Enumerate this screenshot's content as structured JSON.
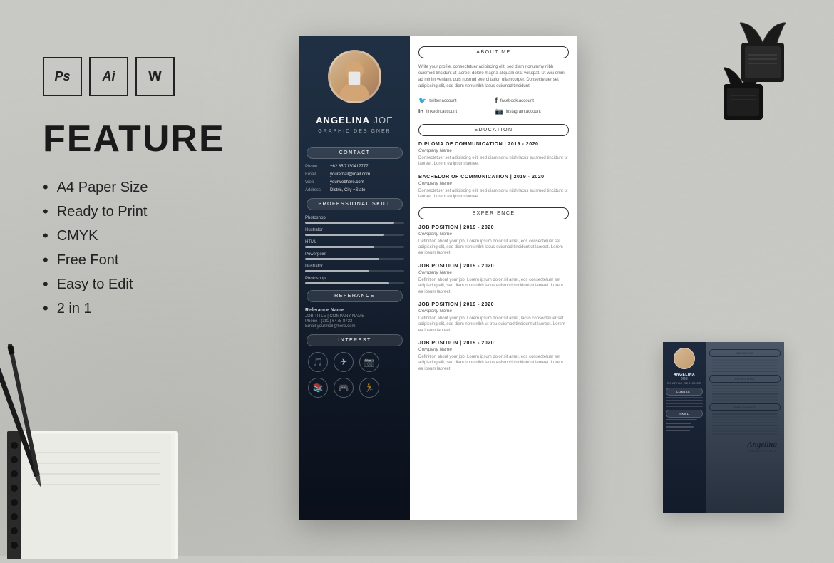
{
  "page": {
    "background_color": "#c8c5c0"
  },
  "software_icons": [
    {
      "id": "ps",
      "label": "Ps"
    },
    {
      "id": "ai",
      "label": "Ai"
    },
    {
      "id": "wd",
      "label": "W"
    }
  ],
  "feature_section": {
    "title": "FEATURE",
    "items": [
      "A4 Paper Size",
      "Ready to Print",
      "CMYK",
      "Free Font",
      "Easy to Edit",
      "2 in 1"
    ]
  },
  "cv_main": {
    "person": {
      "first_name": "ANGELINA",
      "last_name": "JOE",
      "title": "GRAPHIC DESIGNER"
    },
    "sections": {
      "contact": "CONTACT",
      "professional_skill": "PROFESSIONAL SKILL",
      "referance": "REFERANCE",
      "interest": "INTEREST",
      "about_me": "ABOUT ME",
      "education": "EDUCATION",
      "experience": "EXPERIENCE"
    },
    "contact_info": [
      {
        "label": "Phone",
        "value": "+62 85 7130417777"
      },
      {
        "label": "Email",
        "value": "youremail@mail.com"
      },
      {
        "label": "Web",
        "value": "yourwebhere.com"
      },
      {
        "label": "Address",
        "value": "Distric, City +State"
      }
    ],
    "skills": [
      {
        "name": "Photoshop",
        "level": 90
      },
      {
        "name": "Illustrator",
        "level": 80
      },
      {
        "name": "HTML",
        "level": 70
      },
      {
        "name": "Powerpoint",
        "level": 75
      },
      {
        "name": "Illustrator",
        "level": 65
      },
      {
        "name": "Photoshop",
        "level": 85
      }
    ],
    "referance": {
      "name": "Referance Name",
      "job_title": "JOB TITLE | COMPANY NAME",
      "phone": "(382) 6475 8733",
      "email": "yourmail@here.com"
    },
    "social": [
      {
        "icon": "🐦",
        "label": "twitter.account"
      },
      {
        "icon": "f",
        "label": "facebook.account"
      },
      {
        "icon": "in",
        "label": "linkedin.account"
      },
      {
        "icon": "📷",
        "label": "instagram.account"
      }
    ],
    "about_text": "Write your profile, consectetuer adipiscing elit, sed diam nonummy nibh euismod tincidunt ut laoreet dolore magna aliquam erat volutpat. Ut wisi enim ad minim veniam, quis nostrud exerci tation ullamcorper. Donsectetuer set adipiscing elit, sed diam nonu nibh lacus euismod tincidunt.",
    "education": [
      {
        "degree": "DIPLOMA OF COMMUNICATION | 2019 - 2020",
        "company": "Company Name",
        "desc": "Donsectetuer set adipiscing elit, sed diam nonu nibh lacus euismod tincidunt ut laoreet. Lorem ea ipsum laoreet"
      },
      {
        "degree": "BACHELOR OF COMMUNICATION | 2019 - 2020",
        "company": "Company Name",
        "desc": "Donsectetuer set adipiscing elit, sed diam nonu nibh lacus euismod tincidunt ut laoreet. Lorem ea ipsum laoreet"
      }
    ],
    "experience": [
      {
        "title": "JOB POSITION | 2019 - 2020",
        "company": "Company Name",
        "desc": "Definition about your job. Lorem ipsum dolor sit amet, eos consectetuer set adipiscing elit, sed diam nonu nibh lacus euismod tincidunt ut laoreet. Lorem ea ipsum laoreet"
      },
      {
        "title": "JOB POSITION | 2019 - 2020",
        "company": "Company Name",
        "desc": "Definition about your job. Lorem ipsum dolor sit amet, eos consectetuer set adipiscing elit, sed diam nonu nibh lacus euismod tincidunt ut laoreet. Lorem ea ipsum laoreet"
      },
      {
        "title": "JOB POSITION | 2019 - 2020",
        "company": "Company Name",
        "desc": "Definition about your job. Lorem ipsum dolor sit amet, lacus consectetuer set adipiscing elit, sed diam nonu nibh ut treu euismod tincidunt ut laoreet. Lorem ea ipsum laoreet"
      },
      {
        "title": "JOB POSITION | 2019 - 2020",
        "company": "Company Name",
        "desc": "Definition about your job. Lorem ipsum dolor sit amet, eos consectetuer set adipiscing elit, sed diam nonu nibh lacus euismod tincidunt ut laoreet. Lorem ea ipsum laoreet"
      }
    ]
  },
  "thumbnail_cv": {
    "first_name": "ANGELINA",
    "last_name": "JOE",
    "title": "GRAPHIC DESIGNER"
  },
  "signature": {
    "text": "Angelina",
    "sub": "ANGELINA JOE"
  }
}
